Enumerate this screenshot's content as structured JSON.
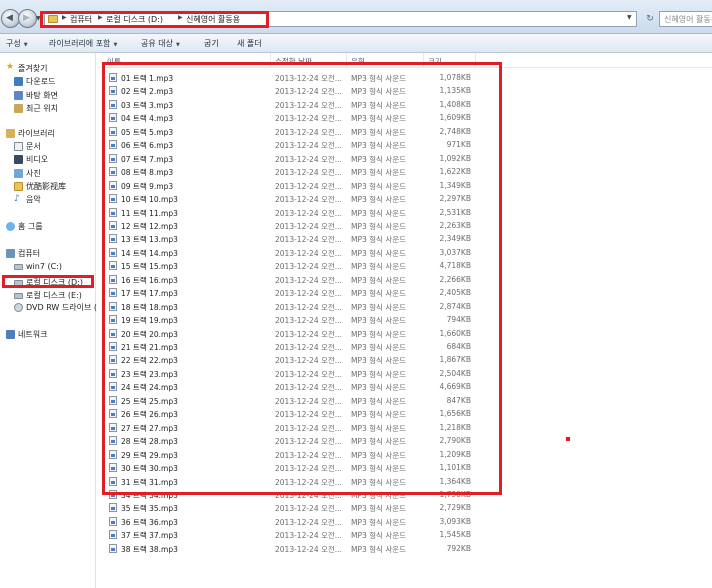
{
  "address_bar": {
    "crumbs": [
      "컴퓨터",
      "로컬 디스크 (D:)",
      "신혜영어 활동용"
    ],
    "search_placeholder": "신혜영어 활동용 검색"
  },
  "toolbar": {
    "items": [
      "구성",
      "라이브러리에 포함",
      "공유 대상",
      "굽기",
      "새 폴더"
    ]
  },
  "navigation": {
    "favorites_header": "즐겨찾기",
    "favorites": [
      "다운로드",
      "바탕 화면",
      "최근 위치"
    ],
    "libraries_header": "라이브러리",
    "libraries": [
      "문서",
      "비디오",
      "사진",
      "优酷影视库",
      "음악"
    ],
    "homegroup": "홈 그룹",
    "computer_header": "컴퓨터",
    "drives": [
      "win7 (C:)",
      "로컬 디스크 (D:)",
      "로컬 디스크 (E:)",
      "DVD RW 드라이브 ("
    ],
    "network": "네트워크"
  },
  "columns": {
    "name": "이름",
    "date": "수정한 날짜",
    "type": "유형",
    "size": "크기"
  },
  "files": [
    {
      "name": "01 트랙 1.mp3",
      "date": "2013-12-24 오전...",
      "type": "MP3 형식 사운드",
      "size": "1,078KB"
    },
    {
      "name": "02 트랙 2.mp3",
      "date": "2013-12-24 오전...",
      "type": "MP3 형식 사운드",
      "size": "1,135KB"
    },
    {
      "name": "03 트랙 3.mp3",
      "date": "2013-12-24 오전...",
      "type": "MP3 형식 사운드",
      "size": "1,408KB"
    },
    {
      "name": "04 트랙 4.mp3",
      "date": "2013-12-24 오전...",
      "type": "MP3 형식 사운드",
      "size": "1,609KB"
    },
    {
      "name": "05 트랙 5.mp3",
      "date": "2013-12-24 오전...",
      "type": "MP3 형식 사운드",
      "size": "2,748KB"
    },
    {
      "name": "06 트랙 6.mp3",
      "date": "2013-12-24 오전...",
      "type": "MP3 형식 사운드",
      "size": "971KB"
    },
    {
      "name": "07 트랙 7.mp3",
      "date": "2013-12-24 오전...",
      "type": "MP3 형식 사운드",
      "size": "1,092KB"
    },
    {
      "name": "08 트랙 8.mp3",
      "date": "2013-12-24 오전...",
      "type": "MP3 형식 사운드",
      "size": "1,622KB"
    },
    {
      "name": "09 트랙 9.mp3",
      "date": "2013-12-24 오전...",
      "type": "MP3 형식 사운드",
      "size": "1,349KB"
    },
    {
      "name": "10 트랙 10.mp3",
      "date": "2013-12-24 오전...",
      "type": "MP3 형식 사운드",
      "size": "2,297KB"
    },
    {
      "name": "11 트랙 11.mp3",
      "date": "2013-12-24 오전...",
      "type": "MP3 형식 사운드",
      "size": "2,531KB"
    },
    {
      "name": "12 트랙 12.mp3",
      "date": "2013-12-24 오전...",
      "type": "MP3 형식 사운드",
      "size": "2,263KB"
    },
    {
      "name": "13 트랙 13.mp3",
      "date": "2013-12-24 오전...",
      "type": "MP3 형식 사운드",
      "size": "2,349KB"
    },
    {
      "name": "14 트랙 14.mp3",
      "date": "2013-12-24 오전...",
      "type": "MP3 형식 사운드",
      "size": "3,037KB"
    },
    {
      "name": "15 트랙 15.mp3",
      "date": "2013-12-24 오전...",
      "type": "MP3 형식 사운드",
      "size": "4,718KB"
    },
    {
      "name": "16 트랙 16.mp3",
      "date": "2013-12-24 오전...",
      "type": "MP3 형식 사운드",
      "size": "2,266KB"
    },
    {
      "name": "17 트랙 17.mp3",
      "date": "2013-12-24 오전...",
      "type": "MP3 형식 사운드",
      "size": "2,405KB"
    },
    {
      "name": "18 트랙 18.mp3",
      "date": "2013-12-24 오전...",
      "type": "MP3 형식 사운드",
      "size": "2,874KB"
    },
    {
      "name": "19 트랙 19.mp3",
      "date": "2013-12-24 오전...",
      "type": "MP3 형식 사운드",
      "size": "794KB"
    },
    {
      "name": "20 트랙 20.mp3",
      "date": "2013-12-24 오전...",
      "type": "MP3 형식 사운드",
      "size": "1,660KB"
    },
    {
      "name": "21 트랙 21.mp3",
      "date": "2013-12-24 오전...",
      "type": "MP3 형식 사운드",
      "size": "684KB"
    },
    {
      "name": "22 트랙 22.mp3",
      "date": "2013-12-24 오전...",
      "type": "MP3 형식 사운드",
      "size": "1,867KB"
    },
    {
      "name": "23 트랙 23.mp3",
      "date": "2013-12-24 오전...",
      "type": "MP3 형식 사운드",
      "size": "2,504KB"
    },
    {
      "name": "24 트랙 24.mp3",
      "date": "2013-12-24 오전...",
      "type": "MP3 형식 사운드",
      "size": "4,669KB"
    },
    {
      "name": "25 트랙 25.mp3",
      "date": "2013-12-24 오전...",
      "type": "MP3 형식 사운드",
      "size": "847KB"
    },
    {
      "name": "26 트랙 26.mp3",
      "date": "2013-12-24 오전...",
      "type": "MP3 형식 사운드",
      "size": "1,656KB"
    },
    {
      "name": "27 트랙 27.mp3",
      "date": "2013-12-24 오전...",
      "type": "MP3 형식 사운드",
      "size": "1,218KB"
    },
    {
      "name": "28 트랙 28.mp3",
      "date": "2013-12-24 오전...",
      "type": "MP3 형식 사운드",
      "size": "2,790KB"
    },
    {
      "name": "29 트랙 29.mp3",
      "date": "2013-12-24 오전...",
      "type": "MP3 형식 사운드",
      "size": "1,209KB"
    },
    {
      "name": "30 트랙 30.mp3",
      "date": "2013-12-24 오전...",
      "type": "MP3 형식 사운드",
      "size": "1,101KB"
    },
    {
      "name": "31 트랙 31.mp3",
      "date": "2013-12-24 오전...",
      "type": "MP3 형식 사운드",
      "size": "1,364KB"
    },
    {
      "name": "34 트랙 34.mp3",
      "date": "2013-12-24 오전...",
      "type": "MP3 형식 사운드",
      "size": "1,790KB"
    },
    {
      "name": "35 트랙 35.mp3",
      "date": "2013-12-24 오전...",
      "type": "MP3 형식 사운드",
      "size": "2,729KB"
    },
    {
      "name": "36 트랙 36.mp3",
      "date": "2013-12-24 오전...",
      "type": "MP3 형식 사운드",
      "size": "3,093KB"
    },
    {
      "name": "37 트랙 37.mp3",
      "date": "2013-12-24 오전...",
      "type": "MP3 형식 사운드",
      "size": "1,545KB"
    },
    {
      "name": "38 트랙 38.mp3",
      "date": "2013-12-24 오전...",
      "type": "MP3 형식 사운드",
      "size": "792KB"
    }
  ],
  "annotation_color": "#e01e24"
}
